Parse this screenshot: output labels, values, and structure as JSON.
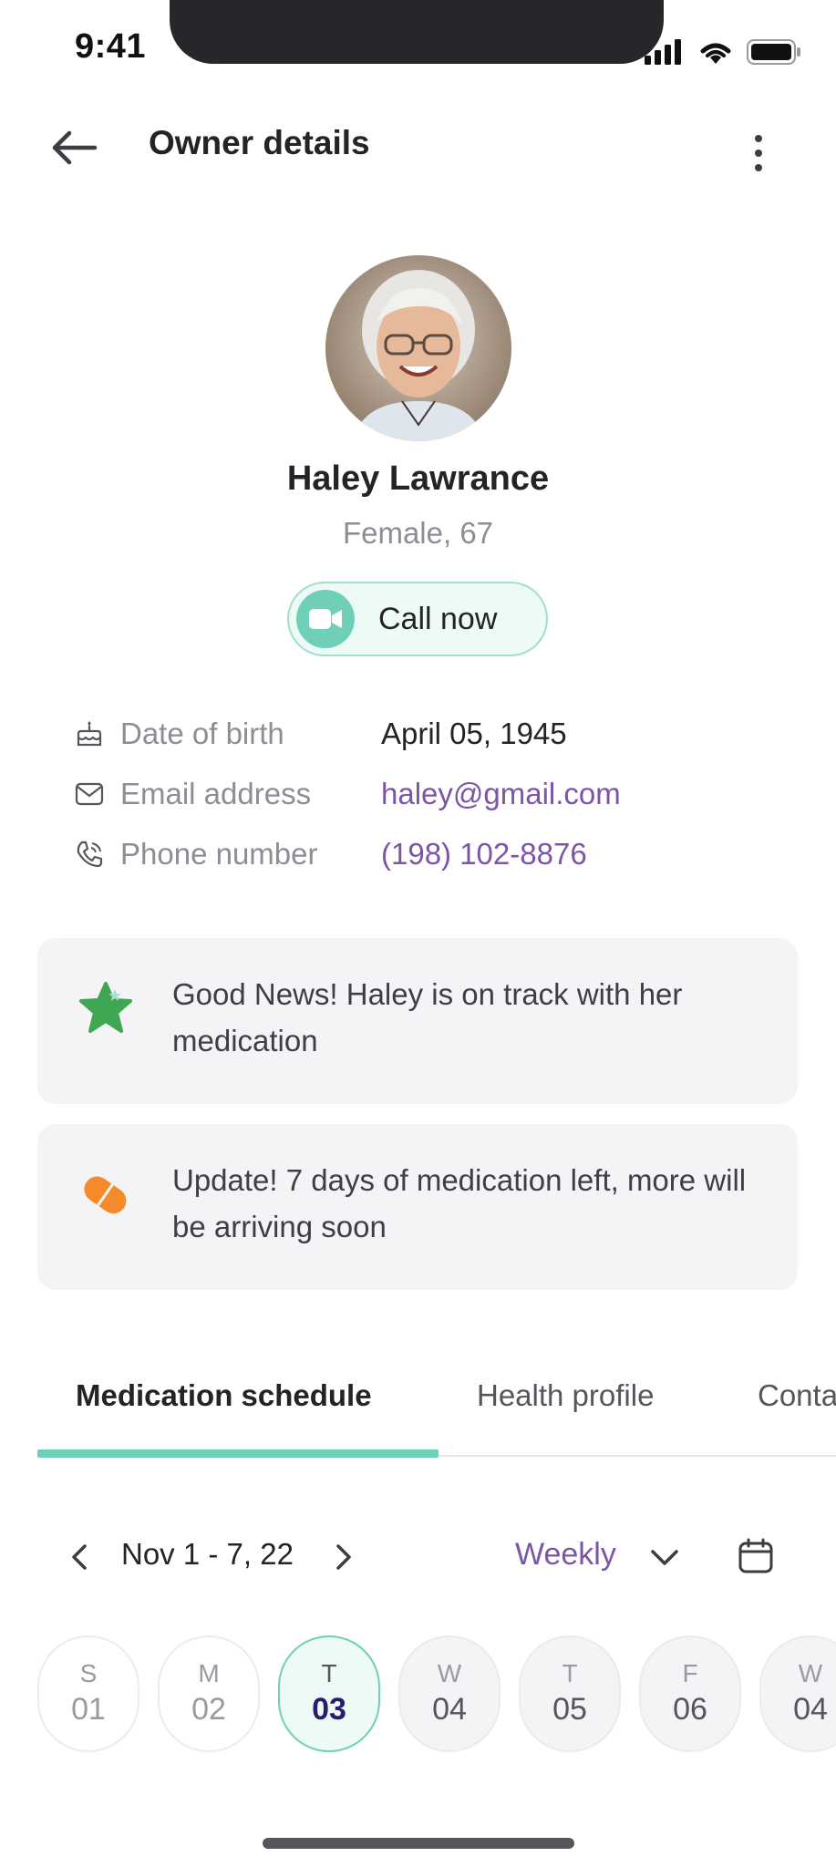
{
  "status_bar": {
    "time": "9:41"
  },
  "header": {
    "title": "Owner details"
  },
  "profile": {
    "name": "Haley Lawrance",
    "subtitle": "Female, 67",
    "call_label": "Call now"
  },
  "info": [
    {
      "label": "Date of birth",
      "value": "April 05, 1945",
      "icon": "cake-icon"
    },
    {
      "label": "Email address",
      "value": "haley@gmail.com",
      "icon": "mail-icon"
    },
    {
      "label": "Phone number",
      "value": "(198) 102-8876",
      "icon": "phone-icon"
    }
  ],
  "cards": [
    {
      "text": "Good News! Haley is on track with her medication",
      "icon": "star-icon",
      "color": "#3fa652"
    },
    {
      "text": "Update! 7 days of medication left, more will be arriving soon",
      "icon": "pill-icon",
      "color": "#f58a2a"
    }
  ],
  "tabs": [
    {
      "label": "Medication schedule",
      "active": true
    },
    {
      "label": "Health profile",
      "active": false
    },
    {
      "label": "Contacts",
      "active": false
    }
  ],
  "schedule": {
    "range": "Nov 1 - 7, 22",
    "view": "Weekly",
    "days": [
      {
        "letter": "S",
        "num": "01"
      },
      {
        "letter": "M",
        "num": "02"
      },
      {
        "letter": "T",
        "num": "03",
        "selected": true
      },
      {
        "letter": "W",
        "num": "04"
      },
      {
        "letter": "T",
        "num": "05"
      },
      {
        "letter": "F",
        "num": "06"
      },
      {
        "letter": "W",
        "num": "04"
      }
    ]
  },
  "colors": {
    "accent": "#70cfb8",
    "link": "#7c55a6",
    "card_bg": "#f4f4f6"
  }
}
